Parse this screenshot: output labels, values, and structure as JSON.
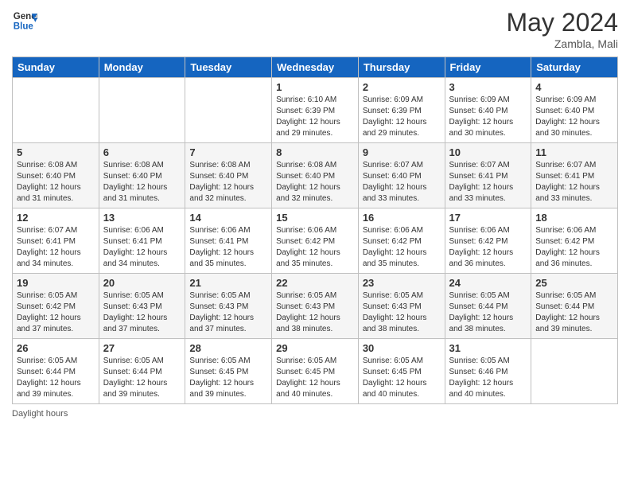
{
  "header": {
    "logo_line1": "General",
    "logo_line2": "Blue",
    "month_title": "May 2024",
    "location": "Zambla, Mali"
  },
  "days_of_week": [
    "Sunday",
    "Monday",
    "Tuesday",
    "Wednesday",
    "Thursday",
    "Friday",
    "Saturday"
  ],
  "footer": {
    "daylight_label": "Daylight hours"
  },
  "weeks": [
    [
      {
        "day": "",
        "info": ""
      },
      {
        "day": "",
        "info": ""
      },
      {
        "day": "",
        "info": ""
      },
      {
        "day": "1",
        "info": "Sunrise: 6:10 AM\nSunset: 6:39 PM\nDaylight: 12 hours\nand 29 minutes."
      },
      {
        "day": "2",
        "info": "Sunrise: 6:09 AM\nSunset: 6:39 PM\nDaylight: 12 hours\nand 29 minutes."
      },
      {
        "day": "3",
        "info": "Sunrise: 6:09 AM\nSunset: 6:40 PM\nDaylight: 12 hours\nand 30 minutes."
      },
      {
        "day": "4",
        "info": "Sunrise: 6:09 AM\nSunset: 6:40 PM\nDaylight: 12 hours\nand 30 minutes."
      }
    ],
    [
      {
        "day": "5",
        "info": "Sunrise: 6:08 AM\nSunset: 6:40 PM\nDaylight: 12 hours\nand 31 minutes."
      },
      {
        "day": "6",
        "info": "Sunrise: 6:08 AM\nSunset: 6:40 PM\nDaylight: 12 hours\nand 31 minutes."
      },
      {
        "day": "7",
        "info": "Sunrise: 6:08 AM\nSunset: 6:40 PM\nDaylight: 12 hours\nand 32 minutes."
      },
      {
        "day": "8",
        "info": "Sunrise: 6:08 AM\nSunset: 6:40 PM\nDaylight: 12 hours\nand 32 minutes."
      },
      {
        "day": "9",
        "info": "Sunrise: 6:07 AM\nSunset: 6:40 PM\nDaylight: 12 hours\nand 33 minutes."
      },
      {
        "day": "10",
        "info": "Sunrise: 6:07 AM\nSunset: 6:41 PM\nDaylight: 12 hours\nand 33 minutes."
      },
      {
        "day": "11",
        "info": "Sunrise: 6:07 AM\nSunset: 6:41 PM\nDaylight: 12 hours\nand 33 minutes."
      }
    ],
    [
      {
        "day": "12",
        "info": "Sunrise: 6:07 AM\nSunset: 6:41 PM\nDaylight: 12 hours\nand 34 minutes."
      },
      {
        "day": "13",
        "info": "Sunrise: 6:06 AM\nSunset: 6:41 PM\nDaylight: 12 hours\nand 34 minutes."
      },
      {
        "day": "14",
        "info": "Sunrise: 6:06 AM\nSunset: 6:41 PM\nDaylight: 12 hours\nand 35 minutes."
      },
      {
        "day": "15",
        "info": "Sunrise: 6:06 AM\nSunset: 6:42 PM\nDaylight: 12 hours\nand 35 minutes."
      },
      {
        "day": "16",
        "info": "Sunrise: 6:06 AM\nSunset: 6:42 PM\nDaylight: 12 hours\nand 35 minutes."
      },
      {
        "day": "17",
        "info": "Sunrise: 6:06 AM\nSunset: 6:42 PM\nDaylight: 12 hours\nand 36 minutes."
      },
      {
        "day": "18",
        "info": "Sunrise: 6:06 AM\nSunset: 6:42 PM\nDaylight: 12 hours\nand 36 minutes."
      }
    ],
    [
      {
        "day": "19",
        "info": "Sunrise: 6:05 AM\nSunset: 6:42 PM\nDaylight: 12 hours\nand 37 minutes."
      },
      {
        "day": "20",
        "info": "Sunrise: 6:05 AM\nSunset: 6:43 PM\nDaylight: 12 hours\nand 37 minutes."
      },
      {
        "day": "21",
        "info": "Sunrise: 6:05 AM\nSunset: 6:43 PM\nDaylight: 12 hours\nand 37 minutes."
      },
      {
        "day": "22",
        "info": "Sunrise: 6:05 AM\nSunset: 6:43 PM\nDaylight: 12 hours\nand 38 minutes."
      },
      {
        "day": "23",
        "info": "Sunrise: 6:05 AM\nSunset: 6:43 PM\nDaylight: 12 hours\nand 38 minutes."
      },
      {
        "day": "24",
        "info": "Sunrise: 6:05 AM\nSunset: 6:44 PM\nDaylight: 12 hours\nand 38 minutes."
      },
      {
        "day": "25",
        "info": "Sunrise: 6:05 AM\nSunset: 6:44 PM\nDaylight: 12 hours\nand 39 minutes."
      }
    ],
    [
      {
        "day": "26",
        "info": "Sunrise: 6:05 AM\nSunset: 6:44 PM\nDaylight: 12 hours\nand 39 minutes."
      },
      {
        "day": "27",
        "info": "Sunrise: 6:05 AM\nSunset: 6:44 PM\nDaylight: 12 hours\nand 39 minutes."
      },
      {
        "day": "28",
        "info": "Sunrise: 6:05 AM\nSunset: 6:45 PM\nDaylight: 12 hours\nand 39 minutes."
      },
      {
        "day": "29",
        "info": "Sunrise: 6:05 AM\nSunset: 6:45 PM\nDaylight: 12 hours\nand 40 minutes."
      },
      {
        "day": "30",
        "info": "Sunrise: 6:05 AM\nSunset: 6:45 PM\nDaylight: 12 hours\nand 40 minutes."
      },
      {
        "day": "31",
        "info": "Sunrise: 6:05 AM\nSunset: 6:46 PM\nDaylight: 12 hours\nand 40 minutes."
      },
      {
        "day": "",
        "info": ""
      }
    ]
  ]
}
